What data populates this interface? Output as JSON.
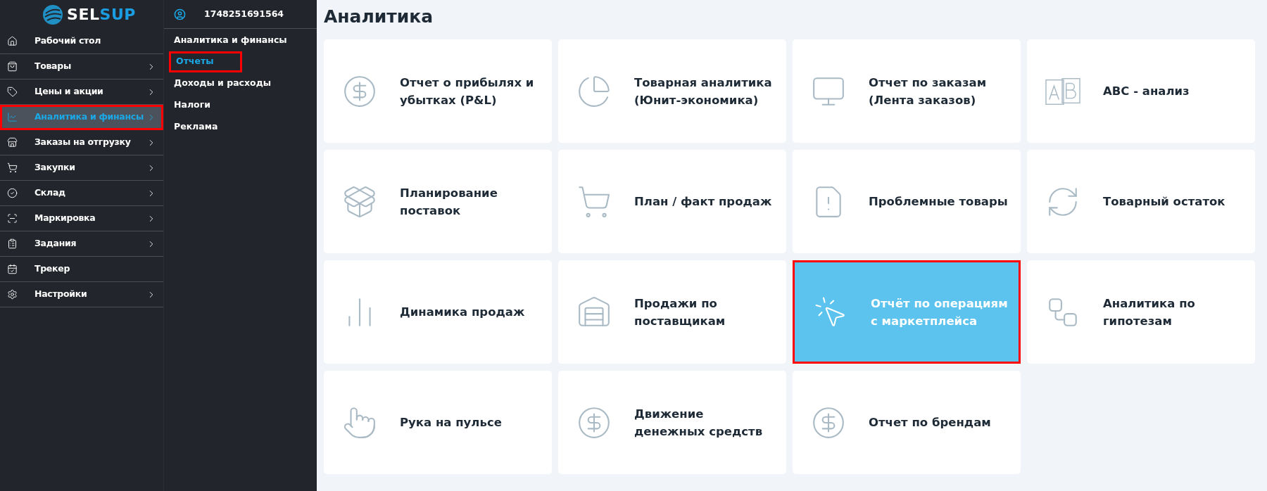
{
  "logo": {
    "text_a": "SEL",
    "text_b": "SUP"
  },
  "sidebar": {
    "items": [
      {
        "label": "Рабочий стол",
        "has_children": false,
        "selected": false,
        "highlighted": false
      },
      {
        "label": "Товары",
        "has_children": true,
        "selected": false,
        "highlighted": false
      },
      {
        "label": "Цены и акции",
        "has_children": true,
        "selected": false,
        "highlighted": false
      },
      {
        "label": "Аналитика и финансы",
        "has_children": true,
        "selected": true,
        "highlighted": true
      },
      {
        "label": "Заказы на отгрузку",
        "has_children": true,
        "selected": false,
        "highlighted": false
      },
      {
        "label": "Закупки",
        "has_children": true,
        "selected": false,
        "highlighted": false
      },
      {
        "label": "Склад",
        "has_children": true,
        "selected": false,
        "highlighted": false
      },
      {
        "label": "Маркировка",
        "has_children": true,
        "selected": false,
        "highlighted": false
      },
      {
        "label": "Задания",
        "has_children": true,
        "selected": false,
        "highlighted": false
      },
      {
        "label": "Трекер",
        "has_children": false,
        "selected": false,
        "highlighted": false
      },
      {
        "label": "Настройки",
        "has_children": true,
        "selected": false,
        "highlighted": false
      }
    ]
  },
  "submenu": {
    "account": "1748251691564",
    "heading": "Аналитика и финансы",
    "items": [
      {
        "label": "Отчеты",
        "selected": true,
        "highlighted": true
      },
      {
        "label": "Доходы и расходы",
        "selected": false,
        "highlighted": false
      },
      {
        "label": "Налоги",
        "selected": false,
        "highlighted": false
      },
      {
        "label": "Реклама",
        "selected": false,
        "highlighted": false
      }
    ]
  },
  "page": {
    "title": "Аналитика",
    "cards": [
      {
        "label": "Отчет о прибылях и убытках (P&L)",
        "selected": false,
        "highlighted": false
      },
      {
        "label": "Товарная аналитика (Юнит-экономика)",
        "selected": false,
        "highlighted": false
      },
      {
        "label": "Отчет по заказам (Лента заказов)",
        "selected": false,
        "highlighted": false
      },
      {
        "label": "ABC - анализ",
        "selected": false,
        "highlighted": false
      },
      {
        "label": "Планирование поставок",
        "selected": false,
        "highlighted": false
      },
      {
        "label": "План / факт продаж",
        "selected": false,
        "highlighted": false
      },
      {
        "label": "Проблемные товары",
        "selected": false,
        "highlighted": false
      },
      {
        "label": "Товарный остаток",
        "selected": false,
        "highlighted": false
      },
      {
        "label": "Динамика продаж",
        "selected": false,
        "highlighted": false
      },
      {
        "label": "Продажи по поставщикам",
        "selected": false,
        "highlighted": false
      },
      {
        "label": "Отчёт по операциям с маркетплейса",
        "selected": true,
        "highlighted": true
      },
      {
        "label": "Аналитика по гипотезам",
        "selected": false,
        "highlighted": false
      },
      {
        "label": "Рука на пульсе",
        "selected": false,
        "highlighted": false
      },
      {
        "label": "Движение денежных средств",
        "selected": false,
        "highlighted": false
      },
      {
        "label": "Отчет по брендам",
        "selected": false,
        "highlighted": false
      }
    ]
  }
}
